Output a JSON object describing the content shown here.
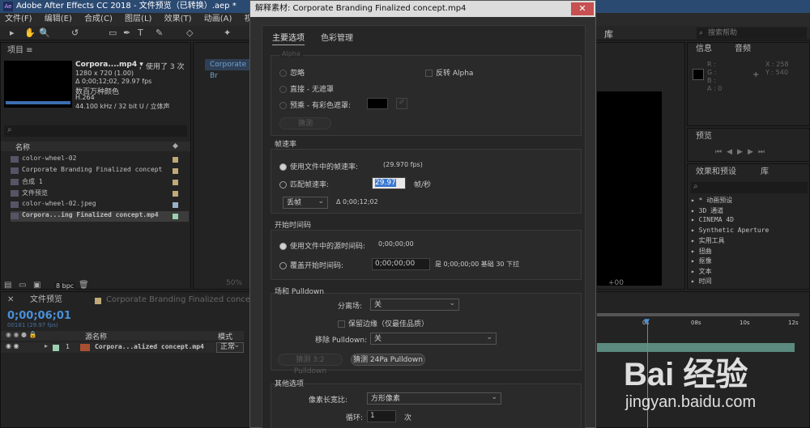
{
  "app": {
    "title": "Adobe After Effects CC 2018 - 文件预览（已转换）.aep *",
    "menu": [
      "文件(F)",
      "编辑(E)",
      "合成(C)",
      "图层(L)",
      "效果(T)",
      "动画(A)",
      "视图(V)",
      "窗口"
    ],
    "help_search": "搜索帮助",
    "library_tab": "库"
  },
  "project": {
    "header": "项目 ≡",
    "clip_name": "Corpora....mp4 ▾",
    "used": "，使用了 3 次",
    "resolution": "1280 x 720 (1.00)",
    "duration": "Δ 0;00;12;02, 29.97 fps",
    "colors": "数百万种颜色",
    "codec": "H.264",
    "audio": "44.100 kHz / 32 bit U / 立体声",
    "col_name": "名称",
    "items": [
      {
        "name": "color-wheel-02",
        "color": "#c0a878"
      },
      {
        "name": "Corporate Branding  Finalized concept",
        "color": "#c0a878"
      },
      {
        "name": "合成 1",
        "color": "#c0a878"
      },
      {
        "name": "文件预览",
        "color": "#c0a878"
      },
      {
        "name": "color-wheel-02.jpeg",
        "color": "#9ab0c8"
      },
      {
        "name": "Corpora...ing  Finalized concept.mp4",
        "color": "#9ad0b0"
      }
    ],
    "bpc": "8 bpc"
  },
  "comp_tab": "Corporate Br",
  "dialog": {
    "title": "解释素材: Corporate Branding  Finalized concept.mp4",
    "close": "✕",
    "tabs": [
      "主要选项",
      "色彩管理"
    ],
    "alpha": {
      "title": "Alpha",
      "ignore": "忽略",
      "invert": "反转 Alpha",
      "straight": "直接 - 无遮罩",
      "premul": "预乘 - 有彩色遮罩:",
      "guess": "猜测"
    },
    "framerate": {
      "title": "帧速率",
      "use_file": "使用文件中的帧速率:",
      "file_rate": "(29.970 fps)",
      "conform": "匹配帧速率:",
      "conform_value": "29.97",
      "unit": "帧/秒",
      "drop": "丢帧",
      "duration": "Δ 0;00;12;02"
    },
    "timecode": {
      "title": "开始时间码",
      "use_file": "使用文件中的源时间码:",
      "file_tc": "0;00;00;00",
      "override": "覆盖开始时间码:",
      "override_value": "0;00;00;00",
      "info": "是 0;00;00;00  基础 30  下拉"
    },
    "fields": {
      "title": "场和 Pulldown",
      "separate_label": "分离场:",
      "separate_value": "关",
      "preserve": "保留边缘（仅最佳品质）",
      "remove_label": "移除 Pulldown:",
      "remove_value": "关",
      "guess32": "猜测 3:2 Pulldown",
      "guess24": "猜测 24Pa Pulldown"
    },
    "other": {
      "title": "其他选项",
      "par_label": "像素长宽比:",
      "par_value": "方形像素",
      "loop_label": "循环:",
      "loop_value": "1",
      "loop_unit": "次"
    }
  },
  "info_panel": {
    "tab1": "信息",
    "tab2": "音频",
    "rgb": [
      "R :",
      "G :",
      "B :",
      "A : 0"
    ],
    "x": "X : 258",
    "y": "Y : 540"
  },
  "preview": {
    "tab": "预览"
  },
  "effects": {
    "tab1": "效果和预设",
    "tab2": "库",
    "items": [
      "▸ * 动画预设",
      "▸ 3D 通道",
      "▸ CINEMA 4D",
      "▸ Synthetic Aperture",
      "▸ 实用工具",
      "▸ 扭曲",
      "▸ 抠像",
      "▸ 文本",
      "▸ 时间"
    ]
  },
  "timeline": {
    "tab": "文件预览",
    "tab2": "Corporate Branding  Finalized concept",
    "timecode": "0;00;06;01",
    "frames": "00181 (29.97 fps)",
    "col_source": "源名称",
    "col_mode": "模式",
    "layer_num": "1",
    "layer_name": "Corpora...alized concept.mp4",
    "layer_mode": "正常",
    "ruler": [
      "0s",
      "08s",
      "10s",
      "12s"
    ],
    "zoom": "50%"
  },
  "watermark": {
    "brand": "Bai 经验",
    "url": "jingyan.baidu.com"
  }
}
